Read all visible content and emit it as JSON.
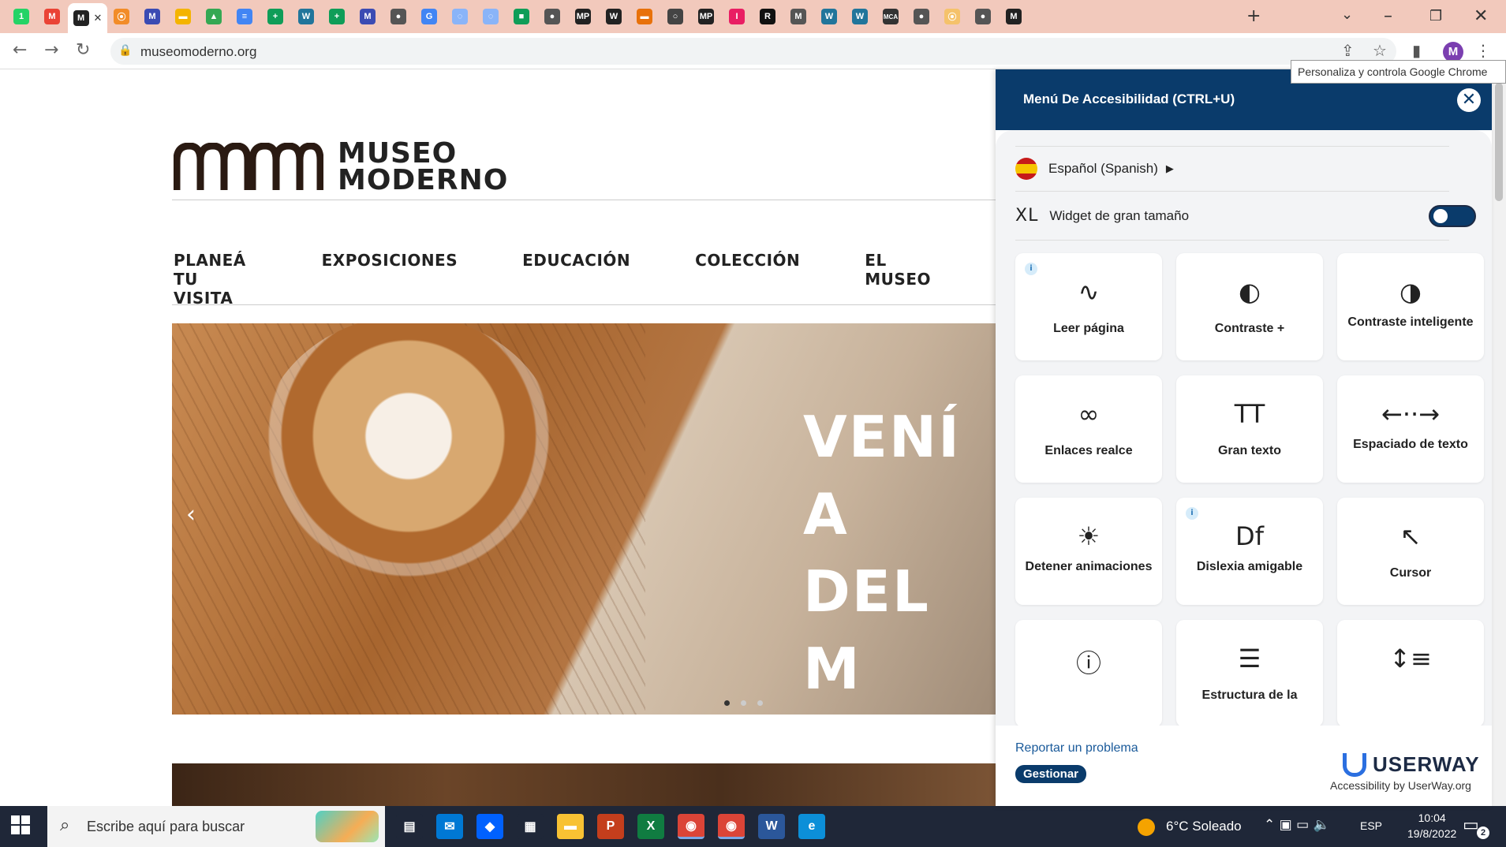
{
  "browser": {
    "tab_count_label": "",
    "url": "museomoderno.org",
    "tooltip": "Personaliza y controla Google Chrome",
    "profile_initial": "M",
    "tabs": [
      {
        "icon": "whatsapp-icon",
        "color": "#25d366",
        "glyph": "1"
      },
      {
        "icon": "gmail-icon",
        "color": "#ea4335",
        "glyph": "M"
      },
      {
        "icon": "museo-moderno-tab-icon",
        "color": "#222222",
        "glyph": "M"
      },
      {
        "icon": "bot-icon",
        "color": "#f28c28",
        "glyph": "⦿"
      },
      {
        "icon": "m-mark-icon",
        "color": "#3b4bb3",
        "glyph": "M"
      },
      {
        "icon": "slides-icon",
        "color": "#f4b400",
        "glyph": "▬"
      },
      {
        "icon": "drive-icon",
        "color": "#34a853",
        "glyph": "▲"
      },
      {
        "icon": "docs-icon",
        "color": "#4285f4",
        "glyph": "≡"
      },
      {
        "icon": "sheets-plus-icon",
        "color": "#0f9d58",
        "glyph": "+"
      },
      {
        "icon": "wordpress-icon",
        "color": "#21759b",
        "glyph": "W"
      },
      {
        "icon": "sheets-plus-icon",
        "color": "#0f9d58",
        "glyph": "+"
      },
      {
        "icon": "m-mark-icon",
        "color": "#3b4bb3",
        "glyph": "M"
      },
      {
        "icon": "globe-icon",
        "color": "#555555",
        "glyph": "●"
      },
      {
        "icon": "google-icon",
        "color": "#4285f4",
        "glyph": "G"
      },
      {
        "icon": "loading-icon",
        "color": "#8ab4f8",
        "glyph": "◌"
      },
      {
        "icon": "loading-icon",
        "color": "#8ab4f8",
        "glyph": "◌"
      },
      {
        "icon": "meet-icon",
        "color": "#0f9d58",
        "glyph": "■"
      },
      {
        "icon": "globe-icon",
        "color": "#555555",
        "glyph": "●"
      },
      {
        "icon": "mp-icon",
        "color": "#222222",
        "glyph": "MP"
      },
      {
        "icon": "w-script-icon",
        "color": "#222222",
        "glyph": "W"
      },
      {
        "icon": "slides-orange-icon",
        "color": "#e8710a",
        "glyph": "▬"
      },
      {
        "icon": "circle-logo-icon",
        "color": "#444444",
        "glyph": "○"
      },
      {
        "icon": "mp-icon",
        "color": "#222222",
        "glyph": "MP"
      },
      {
        "icon": "pink-icon",
        "color": "#e91e63",
        "glyph": "I"
      },
      {
        "icon": "r-icon",
        "color": "#111111",
        "glyph": "R"
      },
      {
        "icon": "m-mark-icon",
        "color": "#555555",
        "glyph": "M"
      },
      {
        "icon": "wordpress-icon",
        "color": "#21759b",
        "glyph": "W"
      },
      {
        "icon": "wordpress-icon",
        "color": "#21759b",
        "glyph": "W"
      },
      {
        "icon": "mca-icon",
        "color": "#333333",
        "glyph": "MCA"
      },
      {
        "icon": "globe-icon",
        "color": "#555555",
        "glyph": "●"
      },
      {
        "icon": "bot-icon",
        "color": "#f5c26b",
        "glyph": "⦿"
      },
      {
        "icon": "globe-icon",
        "color": "#555555",
        "glyph": "●"
      },
      {
        "icon": "museo-moderno-tab-icon",
        "color": "#222222",
        "glyph": "M"
      }
    ]
  },
  "site": {
    "logo_line1": "MUSEO",
    "logo_line2": "MODERNO",
    "nav": [
      "PLANEÁ TU VISITA",
      "EXPOSICIONES",
      "EDUCACIÓN",
      "COLECCIÓN",
      "EL MUSEO"
    ],
    "hero_line1": "VENÍ A",
    "hero_line2": "DEL M",
    "hero_slide_current": 1,
    "hero_slide_total": 3
  },
  "accessibility": {
    "title": "Menú De Accesibilidad (CTRL+U)",
    "language": "Español (Spanish)",
    "xl_icon": "XL",
    "xl_label": "Widget de gran tamaño",
    "xl_enabled": false,
    "cards": [
      {
        "label": "Leer página",
        "icon": "sound-wave-icon",
        "glyph": "∿",
        "info": true
      },
      {
        "label": "Contraste +",
        "icon": "contrast-icon",
        "glyph": "◐",
        "info": false
      },
      {
        "label": "Contraste inteligente",
        "icon": "smart-contrast-icon",
        "glyph": "◑",
        "info": false
      },
      {
        "label": "Enlaces realce",
        "icon": "link-icon",
        "glyph": "∞",
        "info": false
      },
      {
        "label": "Gran texto",
        "icon": "text-size-icon",
        "glyph": "TT",
        "info": false
      },
      {
        "label": "Espaciado de texto",
        "icon": "text-spacing-icon",
        "glyph": "←··→",
        "info": false
      },
      {
        "label": "Detener animaciones",
        "icon": "pause-animations-icon",
        "glyph": "☀",
        "info": false
      },
      {
        "label": "Dislexia amigable",
        "icon": "dyslexia-font-icon",
        "glyph": "Df",
        "info": true
      },
      {
        "label": "Cursor",
        "icon": "cursor-icon",
        "glyph": "↖",
        "info": false
      },
      {
        "label": "",
        "icon": "tooltip-icon",
        "glyph": "ⓘ",
        "info": false
      },
      {
        "label": "Estructura de la",
        "icon": "layers-icon",
        "glyph": "☰",
        "info": false
      },
      {
        "label": "",
        "icon": "line-height-icon",
        "glyph": "↕≡",
        "info": false
      }
    ],
    "report_link": "Reportar un problema",
    "manage_button": "Gestionar",
    "brand": "USERWAY",
    "brand_sub": "Accessibility by UserWay.org"
  },
  "taskbar": {
    "search_placeholder": "Escribe aquí para buscar",
    "weather": "6°C  Soleado",
    "language": "ESP",
    "time": "10:04",
    "date": "19/8/2022",
    "notifications": "2",
    "apps": [
      {
        "icon": "task-view-icon",
        "color": "#1f2738",
        "glyph": "▤"
      },
      {
        "icon": "mail-icon",
        "color": "#0078d4",
        "glyph": "✉"
      },
      {
        "icon": "dropbox-icon",
        "color": "#0061fe",
        "glyph": "◆"
      },
      {
        "icon": "store-icon",
        "color": "#1f2738",
        "glyph": "▦"
      },
      {
        "icon": "file-explorer-icon",
        "color": "#f8c233",
        "glyph": "▬"
      },
      {
        "icon": "powerpoint-icon",
        "color": "#c43e1c",
        "glyph": "P"
      },
      {
        "icon": "excel-icon",
        "color": "#107c41",
        "glyph": "X"
      },
      {
        "icon": "chrome-icon",
        "color": "#db4437",
        "glyph": "◉"
      },
      {
        "icon": "chrome-profile-icon",
        "color": "#db4437",
        "glyph": "◉"
      },
      {
        "icon": "word-icon",
        "color": "#2b579a",
        "glyph": "W"
      },
      {
        "icon": "edge-icon",
        "color": "#0c8fd8",
        "glyph": "e"
      }
    ]
  }
}
